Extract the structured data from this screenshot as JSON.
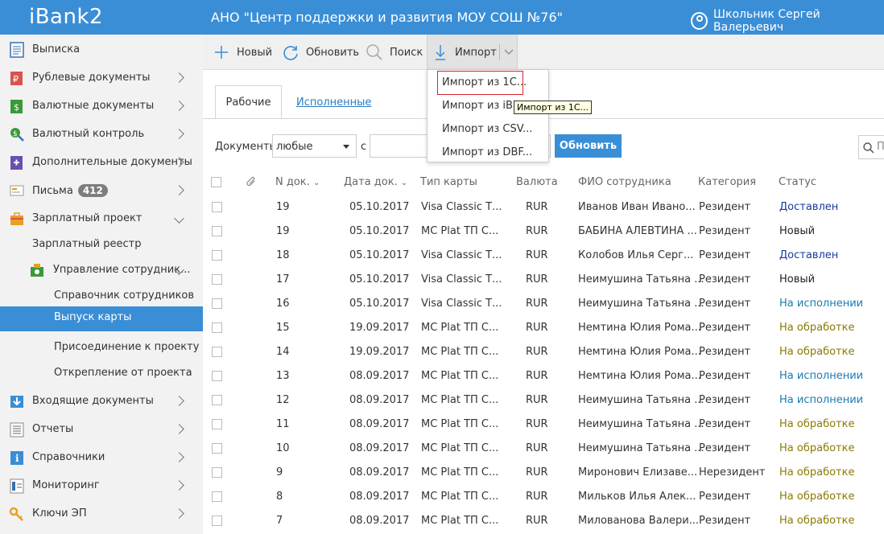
{
  "app": {
    "logo": "iBank2",
    "org_title": "АНО \"Центр поддержки и развития МОУ СОШ №76\"",
    "user_name": "Школьник Сергей Валерьевич"
  },
  "sidebar": {
    "items": [
      {
        "label": "Выписка",
        "icon": "statement-icon"
      },
      {
        "label": "Рублевые документы",
        "icon": "ruble-doc-icon"
      },
      {
        "label": "Валютные документы",
        "icon": "dollar-doc-icon"
      },
      {
        "label": "Валютный контроль",
        "icon": "currency-control-icon"
      },
      {
        "label": "Дополнительные документы",
        "icon": "add-doc-icon"
      },
      {
        "label": "Письма",
        "icon": "letters-icon",
        "badge": "412"
      },
      {
        "label": "Зарплатный проект",
        "icon": "salary-project-icon"
      }
    ],
    "salary_sub": {
      "registry": "Зарплатный реестр",
      "employees_mgmt": "Управление сотрудник...",
      "employees_dir": "Справочник сотрудников",
      "card_issue": "Выпуск карты",
      "join_project": "Присоединение к проекту",
      "detach_project": "Открепление от проекта"
    },
    "bottom_items": [
      {
        "label": "Входящие документы",
        "icon": "incoming-docs-icon"
      },
      {
        "label": "Отчеты",
        "icon": "reports-icon"
      },
      {
        "label": "Справочники",
        "icon": "directories-icon"
      },
      {
        "label": "Мониторинг",
        "icon": "monitoring-icon"
      },
      {
        "label": "Ключи ЭП",
        "icon": "keys-icon"
      }
    ]
  },
  "toolbar": {
    "new_label": "Новый",
    "refresh_label": "Обновить",
    "search_label": "Поиск",
    "import_label": "Импорт"
  },
  "import_menu": {
    "items": [
      "Импорт из 1С...",
      "Импорт из iBank...",
      "Импорт из CSV...",
      "Импорт из DBF..."
    ],
    "visible_item_0": "Импорт из 1С...",
    "visible_item_1": "Импорт из iBan",
    "visible_item_2": "Импорт из CSV...",
    "visible_item_3": "Импорт из DBF...",
    "tooltip": "Импорт из 1С..."
  },
  "tabs": {
    "working": "Рабочие",
    "executed": "Исполненные"
  },
  "filter": {
    "documents_label": "Документы",
    "type_value": "любые",
    "from_label": "с",
    "refresh_button": "Обновить",
    "search_placeholder": "П"
  },
  "table": {
    "headers": {
      "num": "N док.",
      "date": "Дата док.",
      "card_type": "Тип карты",
      "currency": "Валюта",
      "employee": "ФИО сотрудника",
      "category": "Категория",
      "status": "Статус"
    },
    "status_colors": {
      "Доставлен": "#1a3a9c",
      "Новый": "#222222",
      "На исполнении": "#1a7ab0",
      "На обработке": "#8a7a00"
    },
    "rows": [
      {
        "num": "19",
        "date": "05.10.2017",
        "card": "Visa Classic Т...",
        "cur": "RUR",
        "fio": "Иванов Иван Ивано...",
        "cat": "Резидент",
        "status": "Доставлен"
      },
      {
        "num": "19",
        "date": "05.10.2017",
        "card": "MC Plat ТП С...",
        "cur": "RUR",
        "fio": "БАБИНА АЛЕВТИНА ...",
        "cat": "Резидент",
        "status": "Новый"
      },
      {
        "num": "18",
        "date": "05.10.2017",
        "card": "Visa Classic Т...",
        "cur": "RUR",
        "fio": "Колобов Илья Серг...",
        "cat": "Резидент",
        "status": "Доставлен"
      },
      {
        "num": "17",
        "date": "05.10.2017",
        "card": "Visa Classic Т...",
        "cur": "RUR",
        "fio": "Неимушина Татьяна ...",
        "cat": "Резидент",
        "status": "Новый"
      },
      {
        "num": "16",
        "date": "05.10.2017",
        "card": "Visa Classic Т...",
        "cur": "RUR",
        "fio": "Неимушина Татьяна ...",
        "cat": "Резидент",
        "status": "На исполнении"
      },
      {
        "num": "15",
        "date": "19.09.2017",
        "card": "MC Plat ТП С...",
        "cur": "RUR",
        "fio": "Немтина Юлия Рома...",
        "cat": "Резидент",
        "status": "На обработке"
      },
      {
        "num": "14",
        "date": "19.09.2017",
        "card": "MC Plat ТП С...",
        "cur": "RUR",
        "fio": "Немтина Юлия Рома...",
        "cat": "Резидент",
        "status": "На обработке"
      },
      {
        "num": "13",
        "date": "08.09.2017",
        "card": "MC Plat ТП С...",
        "cur": "RUR",
        "fio": "Немтина Юлия Рома...",
        "cat": "Резидент",
        "status": "На исполнении"
      },
      {
        "num": "12",
        "date": "08.09.2017",
        "card": "MC Plat ТП С...",
        "cur": "RUR",
        "fio": "Неимушина Татьяна ...",
        "cat": "Резидент",
        "status": "На исполнении"
      },
      {
        "num": "11",
        "date": "08.09.2017",
        "card": "MC Plat ТП С...",
        "cur": "RUR",
        "fio": "Неимушина Татьяна ...",
        "cat": "Резидент",
        "status": "На обработке"
      },
      {
        "num": "10",
        "date": "08.09.2017",
        "card": "MC Plat ТП С...",
        "cur": "RUR",
        "fio": "Неимушина Татьяна ...",
        "cat": "Резидент",
        "status": "На обработке"
      },
      {
        "num": "9",
        "date": "08.09.2017",
        "card": "MC Plat ТП С...",
        "cur": "RUR",
        "fio": "Миронович Елизаве...",
        "cat": "Нерезидент",
        "status": "На обработке"
      },
      {
        "num": "8",
        "date": "08.09.2017",
        "card": "MC Plat ТП С...",
        "cur": "RUR",
        "fio": "Мильков Илья Алек...",
        "cat": "Резидент",
        "status": "На обработке"
      },
      {
        "num": "7",
        "date": "08.09.2017",
        "card": "MC Plat ТП С...",
        "cur": "RUR",
        "fio": "Милованова Валери...",
        "cat": "Резидент",
        "status": "На обработке"
      }
    ]
  }
}
